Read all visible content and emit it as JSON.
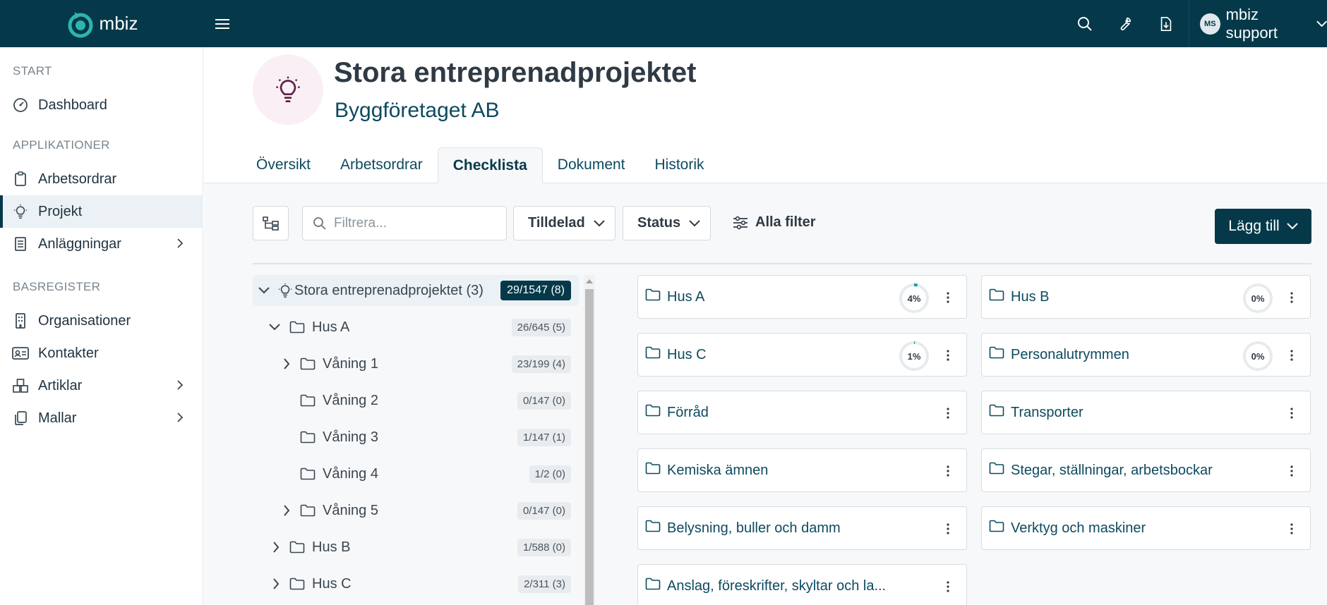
{
  "topbar": {
    "brand": "mbiz",
    "user_initials": "MS",
    "user_name": "mbiz support"
  },
  "sidebar": {
    "sections": [
      "START",
      "APPLIKATIONER",
      "BASREGISTER"
    ],
    "items": [
      {
        "label": "Dashboard",
        "icon": "gauge-icon"
      },
      {
        "label": "Arbetsordrar",
        "icon": "clipboard-icon"
      },
      {
        "label": "Projekt",
        "icon": "lightbulb-icon"
      },
      {
        "label": "Anläggningar",
        "icon": "building-icon"
      },
      {
        "label": "Organisationer",
        "icon": "office-building-icon"
      },
      {
        "label": "Kontakter",
        "icon": "contact-card-icon"
      },
      {
        "label": "Artiklar",
        "icon": "boxes-icon"
      },
      {
        "label": "Mallar",
        "icon": "copy-icon"
      }
    ]
  },
  "header": {
    "title": "Stora entreprenadprojektet",
    "subtitle": "Byggföretaget AB",
    "tabs": [
      "Översikt",
      "Arbetsordrar",
      "Checklista",
      "Dokument",
      "Historik"
    ],
    "active_tab": "Checklista"
  },
  "toolbar": {
    "filter_placeholder": "Filtrera...",
    "assigned": "Tilldelad",
    "status": "Status",
    "all_filters": "Alla filter",
    "add": "Lägg till"
  },
  "tree": [
    {
      "label": "Stora entreprenadprojektet (3)",
      "count": "29/1547 (8)"
    },
    {
      "label": "Hus A",
      "count": "26/645 (5)"
    },
    {
      "label": "Våning 1",
      "count": "23/199 (4)"
    },
    {
      "label": "Våning 2",
      "count": "0/147 (0)"
    },
    {
      "label": "Våning 3",
      "count": "1/147 (1)"
    },
    {
      "label": "Våning 4",
      "count": "1/2 (0)"
    },
    {
      "label": "Våning 5",
      "count": "0/147 (0)"
    },
    {
      "label": "Hus B",
      "count": "1/588 (0)"
    },
    {
      "label": "Hus C",
      "count": "2/311 (3)"
    }
  ],
  "cards": [
    {
      "label": "Hus A",
      "progress": "4%",
      "progress_value": 0.04
    },
    {
      "label": "Hus B",
      "progress": "0%",
      "progress_value": 0
    },
    {
      "label": "Hus C",
      "progress": "1%",
      "progress_value": 0.01
    },
    {
      "label": "Personalutrymmen",
      "progress": "0%",
      "progress_value": 0
    },
    {
      "label": "Förråd"
    },
    {
      "label": "Transporter"
    },
    {
      "label": "Kemiska ämnen"
    },
    {
      "label": "Stegar, ställningar, arbetsbockar"
    },
    {
      "label": "Belysning, buller och damm"
    },
    {
      "label": "Verktyg och maskiner"
    },
    {
      "label": "Anslag, föreskrifter, skyltar och la..."
    }
  ],
  "colors": {
    "primary": "#05394a",
    "accent": "#1aa095",
    "active_bg": "#ebf1f4"
  }
}
